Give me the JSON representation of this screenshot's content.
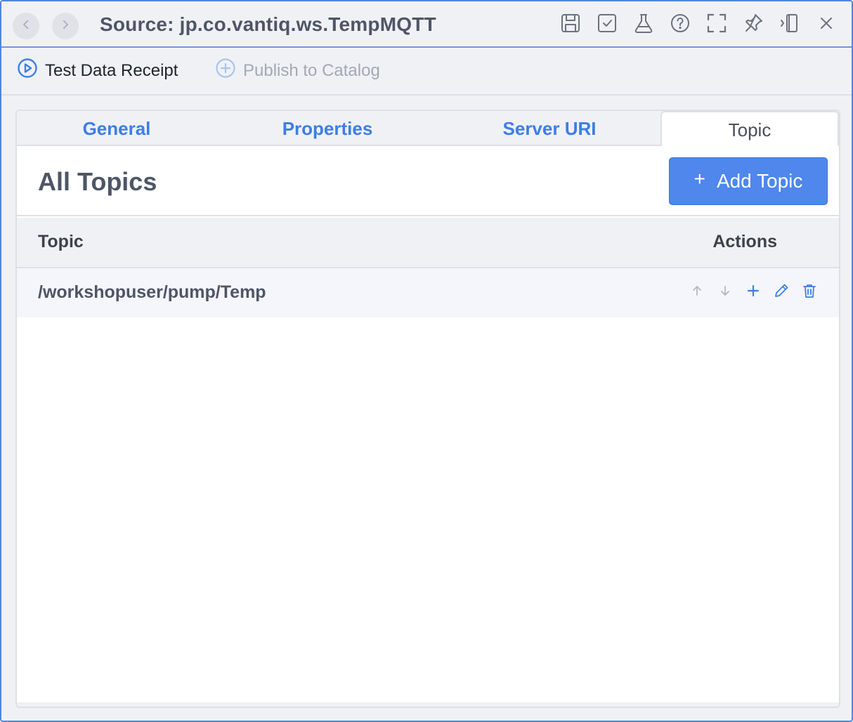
{
  "window": {
    "title": "Source: jp.co.vantiq.ws.TempMQTT",
    "icons": [
      "back-icon",
      "forward-icon",
      "save-icon",
      "check-icon",
      "flask-icon",
      "help-icon",
      "expand-icon",
      "pin-icon",
      "dock-icon",
      "close-icon"
    ]
  },
  "toolbar": {
    "test_label": "Test Data Receipt",
    "publish_label": "Publish to Catalog"
  },
  "tabs": [
    {
      "label": "General",
      "active": false
    },
    {
      "label": "Properties",
      "active": false
    },
    {
      "label": "Server URI",
      "active": false
    },
    {
      "label": "Topic",
      "active": true
    }
  ],
  "section": {
    "title": "All Topics",
    "add_label": "Add Topic",
    "add_symbol": "+"
  },
  "table": {
    "columns": [
      "Topic",
      "Actions"
    ],
    "rows": [
      {
        "topic": "/workshopuser/pump/Temp"
      }
    ]
  },
  "colors": {
    "accent": "#3d7ee6",
    "button": "#4f87ec",
    "disabled": "#b3b8c2"
  }
}
